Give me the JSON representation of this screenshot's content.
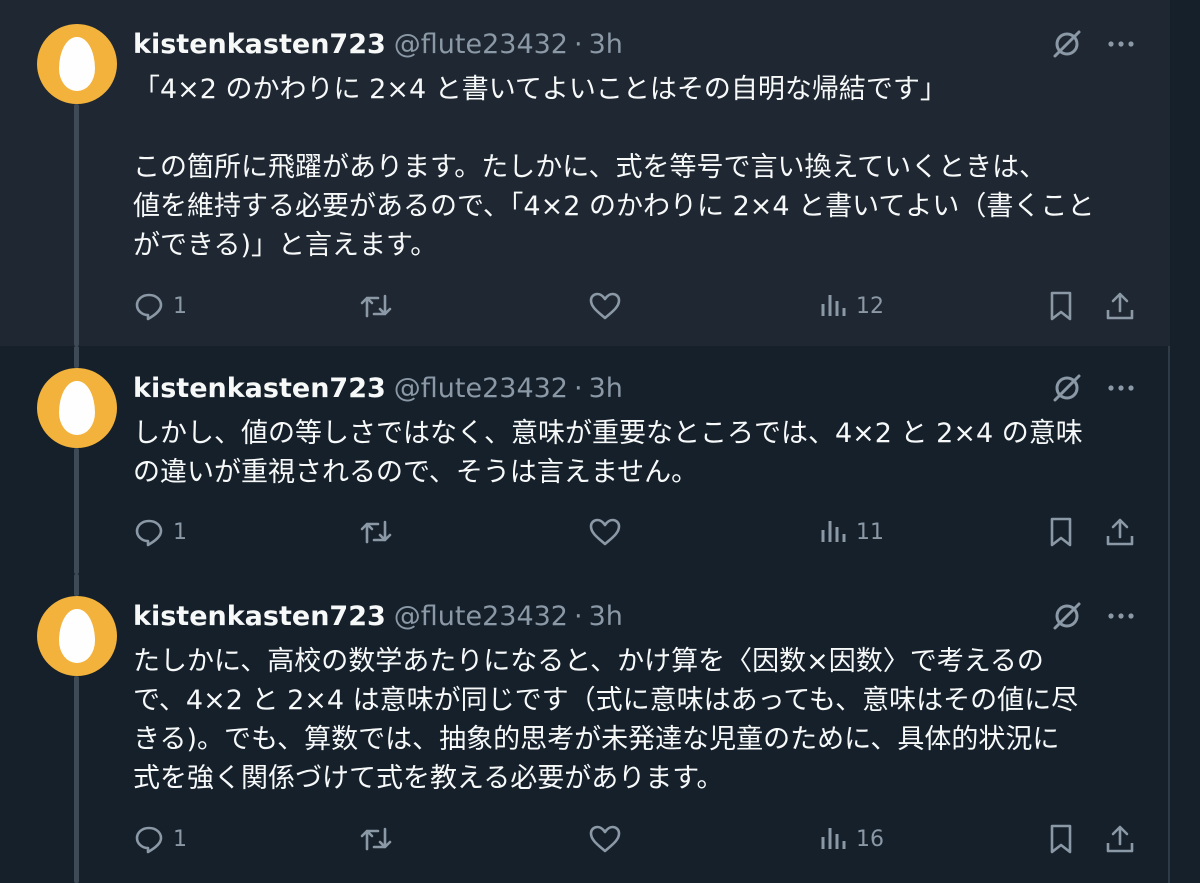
{
  "colors": {
    "background": "#15202b",
    "highlighted_row": "#1e2732",
    "avatar": "#f2b23b",
    "muted": "#8b98a5",
    "text": "#f7f9f9"
  },
  "tweets": [
    {
      "author": {
        "name": "kistenkasten723",
        "handle": "@flute23432",
        "separator": "·",
        "time": "3h",
        "avatar_icon": "default-egg-avatar"
      },
      "lines": [
        "「4×2 のかわりに 2×4 と書いてよいことはその自明な帰結です」",
        "",
        "この箇所に飛躍があります。たしかに、式を等号で言い換えていくときは、",
        "値を維持する必要があるので、「4×2 のかわりに 2×4 と書いてよい（書くこと",
        "ができる)」と言えます。"
      ],
      "actions": {
        "replies": "1",
        "reposts": "",
        "likes": "",
        "views": "12"
      }
    },
    {
      "author": {
        "name": "kistenkasten723",
        "handle": "@flute23432",
        "separator": "·",
        "time": "3h",
        "avatar_icon": "default-egg-avatar"
      },
      "lines": [
        "しかし、値の等しさではなく、意味が重要なところでは、4×2 と 2×4 の意味",
        "の違いが重視されるので、そうは言えません。"
      ],
      "actions": {
        "replies": "1",
        "reposts": "",
        "likes": "",
        "views": "11"
      }
    },
    {
      "author": {
        "name": "kistenkasten723",
        "handle": "@flute23432",
        "separator": "·",
        "time": "3h",
        "avatar_icon": "default-egg-avatar"
      },
      "lines": [
        "たしかに、高校の数学あたりになると、かけ算を〈因数×因数〉で考えるの",
        "で、4×2 と 2×4 は意味が同じです（式に意味はあっても、意味はその値に尽",
        "きる)。でも、算数では、抽象的思考が未発達な児童のために、具体的状況に",
        "式を強く関係づけて式を教える必要があります。"
      ],
      "actions": {
        "replies": "1",
        "reposts": "",
        "likes": "",
        "views": "16"
      }
    }
  ]
}
